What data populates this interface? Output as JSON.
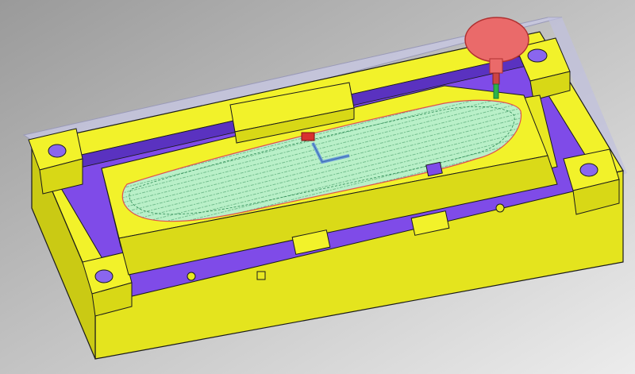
{
  "viewport": {
    "background_top": "#9a9a9a",
    "background_bottom": "#ececec"
  },
  "colors": {
    "mold_yellow": "#f2f22a",
    "mold_yellow_side": "#d8d816",
    "mold_yellow_dark": "#b9b912",
    "mold_outline": "#1a1a1a",
    "pocket_purple": "#7f4be8",
    "pocket_purple_dark": "#5a32c0",
    "stock_glass": "#c8c8e6",
    "toolpath_green": "#b9f0c8",
    "toolpath_line": "#2d8a55",
    "toolpath_red": "#d83030",
    "cutter_holder": "#ea6a6a",
    "cutter_holder_edge": "#b03030",
    "cutter_tip": "#2bb24a",
    "triad_axis": "#6a9cd8"
  },
  "icons": {
    "cutter_tool": "cutter-tool-icon",
    "coordinate_triad": "coordinate-triad-icon"
  }
}
